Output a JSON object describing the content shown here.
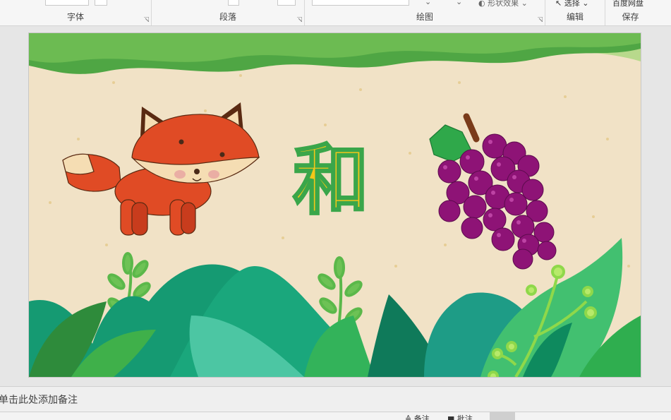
{
  "ribbon": {
    "groups": [
      {
        "label": "字体"
      },
      {
        "label": "段落"
      },
      {
        "label": "绘图"
      },
      {
        "label": "编辑"
      },
      {
        "label": "保存"
      }
    ],
    "shape_effects_label": "形状效果",
    "select_label": "选择",
    "baidu_label": "百度网盘"
  },
  "slide": {
    "character": "和"
  },
  "notes": {
    "placeholder": "单击此处添加备注"
  },
  "statusbar": {
    "notes_label": "备注",
    "comments_label": "批注"
  },
  "colors": {
    "accent_green": "#3aa64a",
    "character_yellow": "#f3c719",
    "fox_orange": "#e04b25",
    "grape_purple": "#8e1376",
    "background_beige": "#f1e2c6"
  }
}
